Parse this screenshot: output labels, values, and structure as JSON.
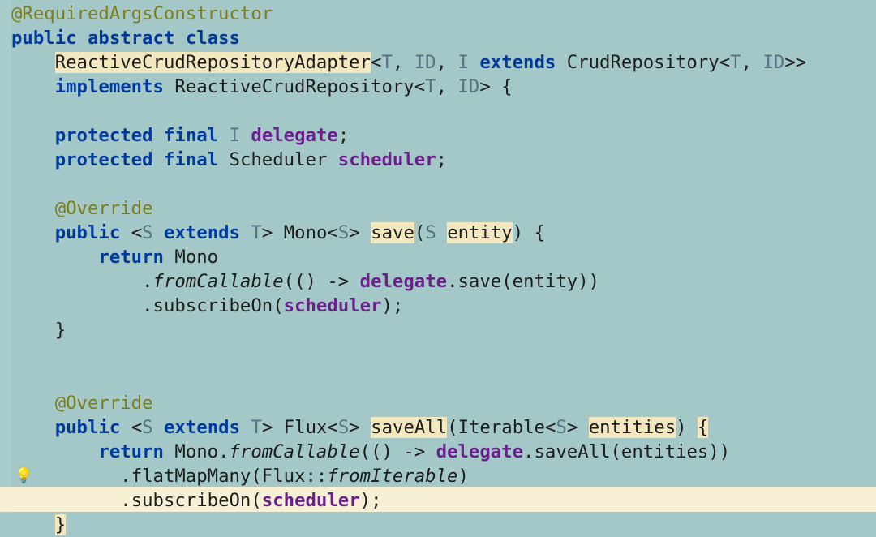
{
  "code": {
    "l1": {
      "ann": "@RequiredArgsConstructor"
    },
    "l2": {
      "kw_public": "public",
      "kw_abstract": "abstract",
      "kw_class": "class"
    },
    "l3": {
      "name": "ReactiveCrudRepositoryAdapter",
      "lt1": "<",
      "t1": "T",
      "c1": ",",
      "sp1": " ",
      "id": "ID",
      "c2": ",",
      "sp2": " ",
      "i": "I",
      "sp3": " ",
      "kw_ext": "extends",
      "sp4": " ",
      "crud": "CrudRepository",
      "lt2": "<",
      "t2": "T",
      "c3": ",",
      "sp5": " ",
      "id2": "ID",
      "gtgt": ">>"
    },
    "l4": {
      "kw_impl": "implements",
      "sp": " ",
      "rcr": "ReactiveCrudRepository",
      "lt": "<",
      "t": "T",
      "c": ",",
      "sp2": " ",
      "id": "ID",
      "gt": ">",
      "sp3": " ",
      "br": "{"
    },
    "l6": {
      "kw_prot": "protected",
      "kw_final": "final",
      "typ_I": "I",
      "field": "delegate",
      "semi": ";"
    },
    "l7": {
      "kw_prot": "protected",
      "kw_final": "final",
      "typ_Sched": "Scheduler",
      "field": "scheduler",
      "semi": ";"
    },
    "l9": {
      "ann": "@Override"
    },
    "l10": {
      "kw_public": "public",
      "lt": "<",
      "s": "S",
      "sp": " ",
      "kw_ext": "extends",
      "sp2": " ",
      "t": "T",
      "gt": ">",
      "mono": "Mono",
      "lt2": "<",
      "s2": "S",
      "gt2": ">",
      "sp3": " ",
      "save": "save",
      "lp": "(",
      "s3": "S",
      "sp4": " ",
      "ent": "entity",
      "rp": ")",
      "sp5": " ",
      "br": "{"
    },
    "l11": {
      "kw_return": "return",
      "mono": "Mono"
    },
    "l12": {
      "dot": ".",
      "fc": "fromCallable",
      "lp": "(",
      "par": "()",
      "sp": " ",
      "arrow": "->",
      "sp2": " ",
      "del": "delegate",
      "dot2": ".",
      "save": "save",
      "lp2": "(",
      "ent": "entity",
      "rp2": ")",
      "rp": ")"
    },
    "l13": {
      "dot": ".",
      "so": "subscribeOn",
      "lp": "(",
      "sch": "scheduler",
      "rp": ")",
      "semi": ";"
    },
    "l14": {
      "br": "}"
    },
    "l17": {
      "ann": "@Override"
    },
    "l18": {
      "kw_public": "public",
      "lt": "<",
      "s": "S",
      "sp": " ",
      "kw_ext": "extends",
      "sp2": " ",
      "t": "T",
      "gt": ">",
      "flux": "Flux",
      "lt2": "<",
      "s2": "S",
      "gt2": ">",
      "sp3": " ",
      "saveall": "saveAll",
      "lp": "(",
      "iter": "Iterable",
      "lt3": "<",
      "s3": "S",
      "gt3": ">",
      "sp4": " ",
      "ents": "entities",
      "rp": ")",
      "sp5": " ",
      "br": "{"
    },
    "l19": {
      "kw_return": "return",
      "mono": "Mono",
      "dot": ".",
      "fc": "fromCallable",
      "lp": "(",
      "par": "()",
      "sp": " ",
      "arrow": "->",
      "sp2": " ",
      "del": "delegate",
      "dot2": ".",
      "sa": "saveAll",
      "lp2": "(",
      "ents": "entities",
      "rp2": ")",
      "rp": ")"
    },
    "l20": {
      "dot": ".",
      "fmm": "flatMapMany",
      "lp": "(",
      "flux": "Flux",
      "cc": "::",
      "fi": "fromIterable",
      "rp": ")"
    },
    "l21": {
      "dot": ".",
      "so": "subscribeOn",
      "lp": "(",
      "sch": "scheduler",
      "rp": ")",
      "semi": ";"
    },
    "l22": {
      "br": "}"
    }
  },
  "icons": {
    "bulb": "💡"
  }
}
